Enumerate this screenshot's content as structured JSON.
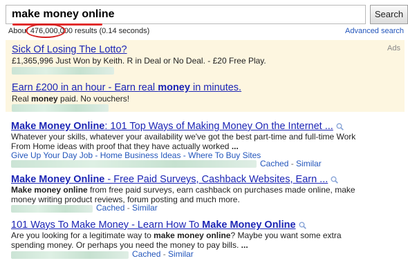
{
  "search": {
    "query": "make money online",
    "button_label": "Search",
    "advanced_search": "Advanced search"
  },
  "stats": {
    "prefix": "About ",
    "count": "476,000,000",
    "suffix": " results (0.14 seconds)"
  },
  "ads": {
    "label": "Ads",
    "items": [
      {
        "title": "Sick Of Losing The Lotto?",
        "desc": "£1,365,996 Just Won by Keith. R in Deal or No Deal. - £20 Free Play."
      },
      {
        "title_a": "Earn £200 in an hour - Earn real ",
        "title_b": "money",
        "title_c": " in minutes.",
        "desc_a": "Real ",
        "desc_b": "money",
        "desc_c": " paid. No vouchers!"
      }
    ]
  },
  "results": [
    {
      "title_a": "Make Money Online",
      "title_b": ": 101 Top Ways of Making Money On the Internet ...",
      "snippet_1": "Whatever your skills, whatever your availability we've got the best part-time and full-time Work",
      "snippet_2": "From Home ideas with proof that they have actually worked ",
      "snippet_2_bold": "...",
      "sitelinks": "Give Up Your Day Job - Home Business Ideas - Where To Buy Sites",
      "cached": "Cached",
      "similar": "Similar",
      "sep": " - "
    },
    {
      "title_a": "Make Money Online",
      "title_b": " - Free Paid Surveys, Cashback Websites, Earn ...",
      "snippet_1_bold": "Make money online",
      "snippet_1": " from free paid surveys, earn cashback on purchases made online, make",
      "snippet_2": "money writing product reviews, forum posting and much more.",
      "cached": "Cached",
      "similar": "Similar",
      "sep": " - "
    },
    {
      "title_a": "101 Ways To Make Money - Learn How To ",
      "title_b": "Make Money Online",
      "snippet_1_a": "Are you looking for a legitimate way to ",
      "snippet_1_bold": "make money online",
      "snippet_1_b": "? Maybe you want some extra",
      "snippet_2": "spending money. Or perhaps you need the money to pay bills. ",
      "snippet_2_bold": "...",
      "cached": "Cached",
      "similar": "Similar",
      "sep": " - "
    }
  ],
  "colors": {
    "link": "#1c25b5",
    "url": "#2255bb",
    "ads_bg": "#fdf6e0",
    "annotation_red": "#d42020"
  }
}
